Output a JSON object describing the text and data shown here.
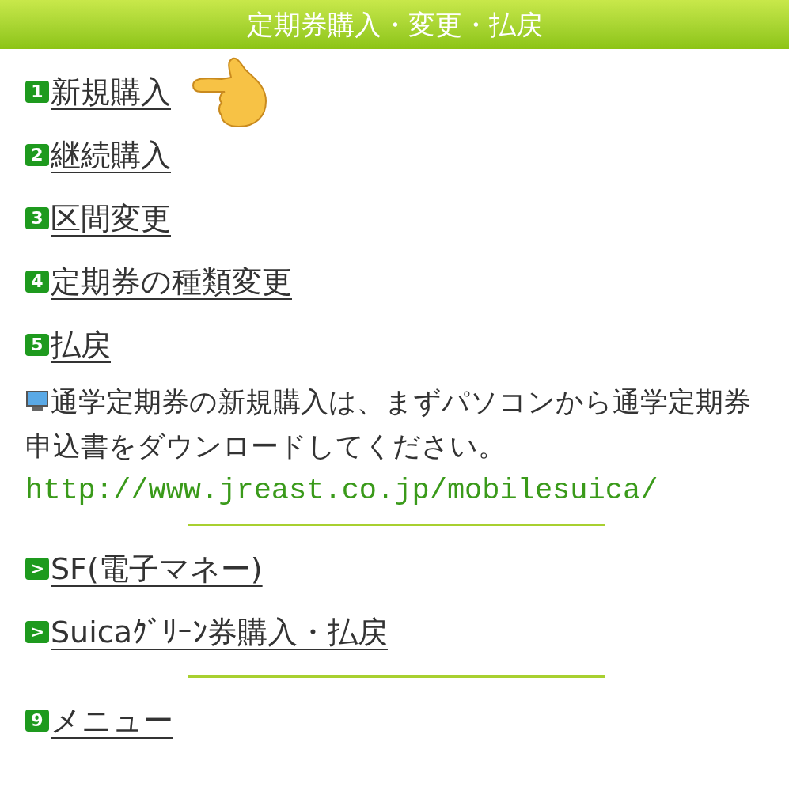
{
  "header": {
    "title": "定期券購入・変更・払戻"
  },
  "menu_items": [
    {
      "badge": "1",
      "label": "新規購入",
      "pointer": true
    },
    {
      "badge": "2",
      "label": "継続購入",
      "pointer": false
    },
    {
      "badge": "3",
      "label": "区間変更",
      "pointer": false
    },
    {
      "badge": "4",
      "label": "定期券の種類変更",
      "pointer": false
    },
    {
      "badge": "5",
      "label": "払戻",
      "pointer": false
    }
  ],
  "notice": {
    "text": "通学定期券の新規購入は、まずパソコンから通学定期券申込書をダウンロードしてください。",
    "url": "http://www.jreast.co.jp/mobilesuica/"
  },
  "related_links": [
    {
      "badge": ">",
      "label": "SF(電子マネー)"
    },
    {
      "badge": ">",
      "label": "Suicaｸﾞﾘｰﾝ券購入・払戻"
    }
  ],
  "footer_links": [
    {
      "badge": "9",
      "label": "メニュー"
    }
  ]
}
